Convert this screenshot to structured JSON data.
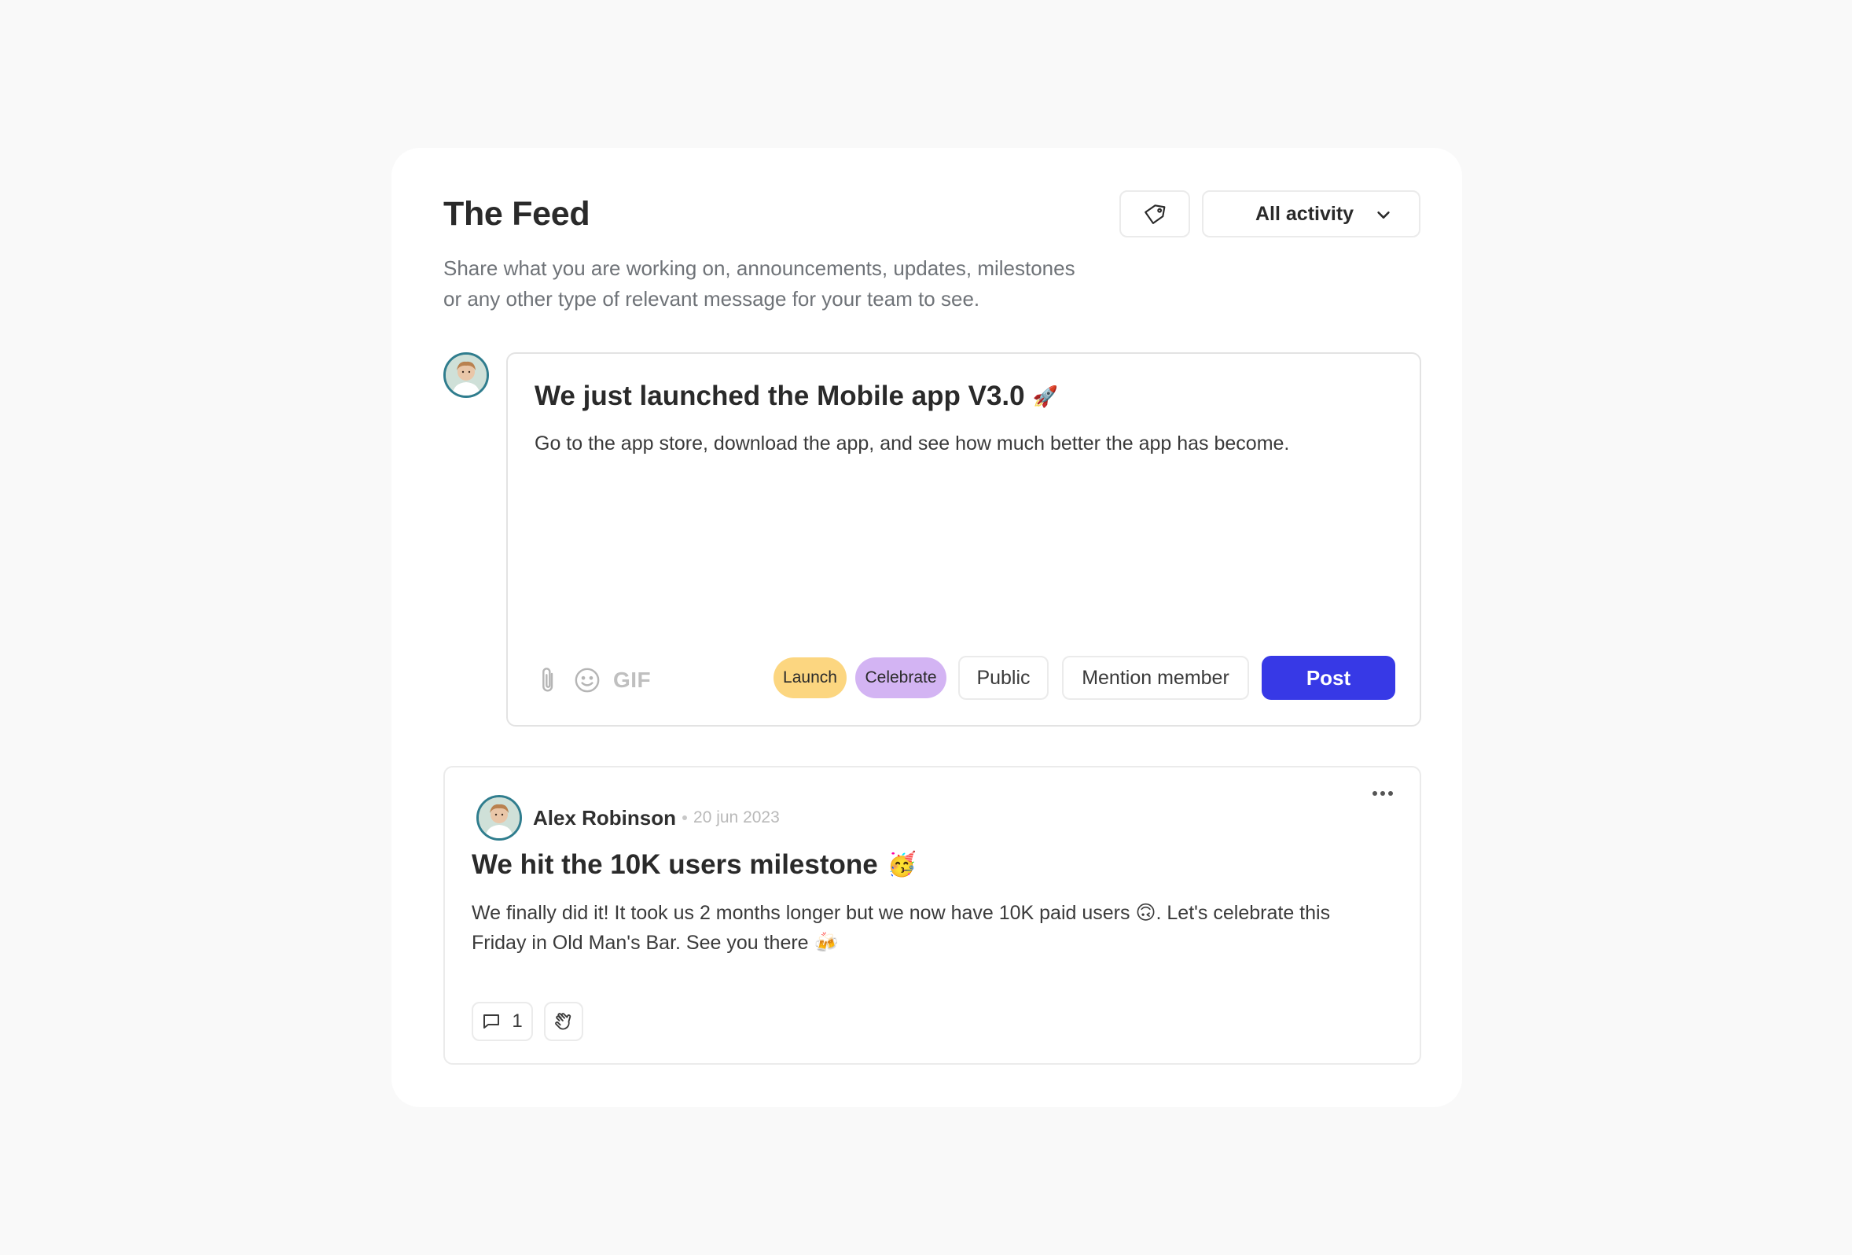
{
  "feed": {
    "title": "The Feed",
    "subtitle_line1": "Share what you are working on, announcements, updates, milestones",
    "subtitle_line2": "or any other type of relevant message for your team to see.",
    "filter_label": "All activity"
  },
  "composer": {
    "title": "We just launched the Mobile app V3.0",
    "title_emoji": "🚀",
    "body": "Go to the app store, download the app, and see how much better the app has become.",
    "gif_label": "GIF",
    "tags": [
      {
        "label": "Launch",
        "color": "#fcd680"
      },
      {
        "label": "Celebrate",
        "color": "#d3b4f3"
      }
    ],
    "visibility_label": "Public",
    "mention_label": "Mention member",
    "post_label": "Post",
    "post_color": "#3739e6"
  },
  "post": {
    "author": "Alex Robinson",
    "date": "20 jun 2023",
    "title": "We hit the 10K users milestone",
    "title_emoji": "🥳",
    "body_line1_a": "We finally did it! It took us 2 months longer but we now have 10K paid users",
    "body_line1_emoji": "🙃",
    "body_line1_b": ". Let's celebrate this",
    "body_line2_a": "Friday in Old Man's Bar. See you there",
    "body_line2_emoji": "🍻",
    "comment_count": "1"
  }
}
